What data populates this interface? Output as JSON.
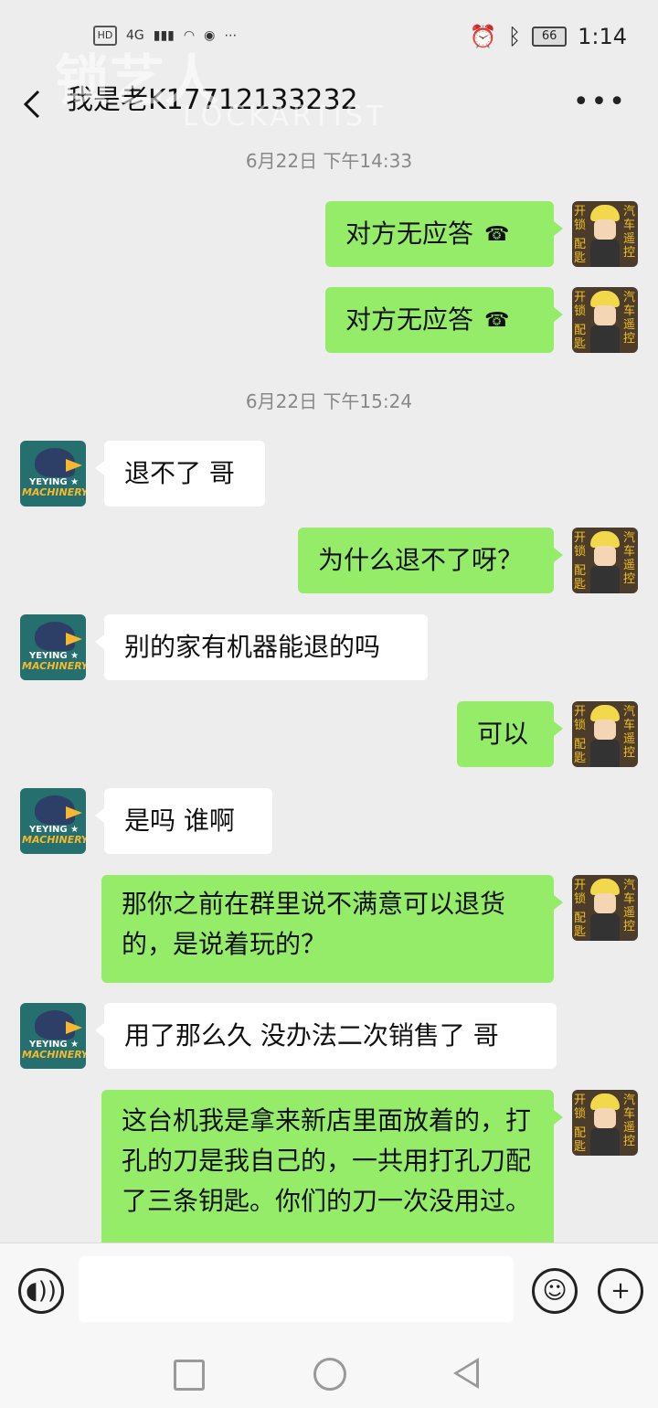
{
  "status_bar": {
    "hd": "HD",
    "net": "4G",
    "battery": "66",
    "time": "1:14"
  },
  "header": {
    "title": "我是老K17712133232",
    "more": "•••"
  },
  "watermark": {
    "cn": "锁艺人",
    "en": "LOCKARTIST"
  },
  "avatar_labels": {
    "brand_line1": "YEYING ★",
    "brand_line2": "MACHINERY",
    "user_tl": "开锁",
    "user_bl": "配匙",
    "user_right": "汽车遥控"
  },
  "messages": {
    "ts1": "6月22日 下午14:33",
    "m1": "对方无应答",
    "m2": "对方无应答",
    "ts2": "6月22日 下午15:24",
    "m3": "退不了 哥",
    "m4": "为什么退不了呀？",
    "m5": "别的家有机器能退的吗",
    "m6": "可以",
    "m7": "是吗  谁啊",
    "m8": "那你之前在群里说不满意可以退货的，是说着玩的？",
    "m9": "用了那么久  没办法二次销售了  哥",
    "m10": "这台机我是拿来新店里面放着的，打孔的刀是我自己的，一共用打孔刀配了三条钥匙。你们的刀一次没用过。"
  },
  "icons": {
    "call": "phone-hangup-icon",
    "voice": "voice-icon",
    "emoji": "emoji-icon",
    "plus": "plus-icon"
  }
}
